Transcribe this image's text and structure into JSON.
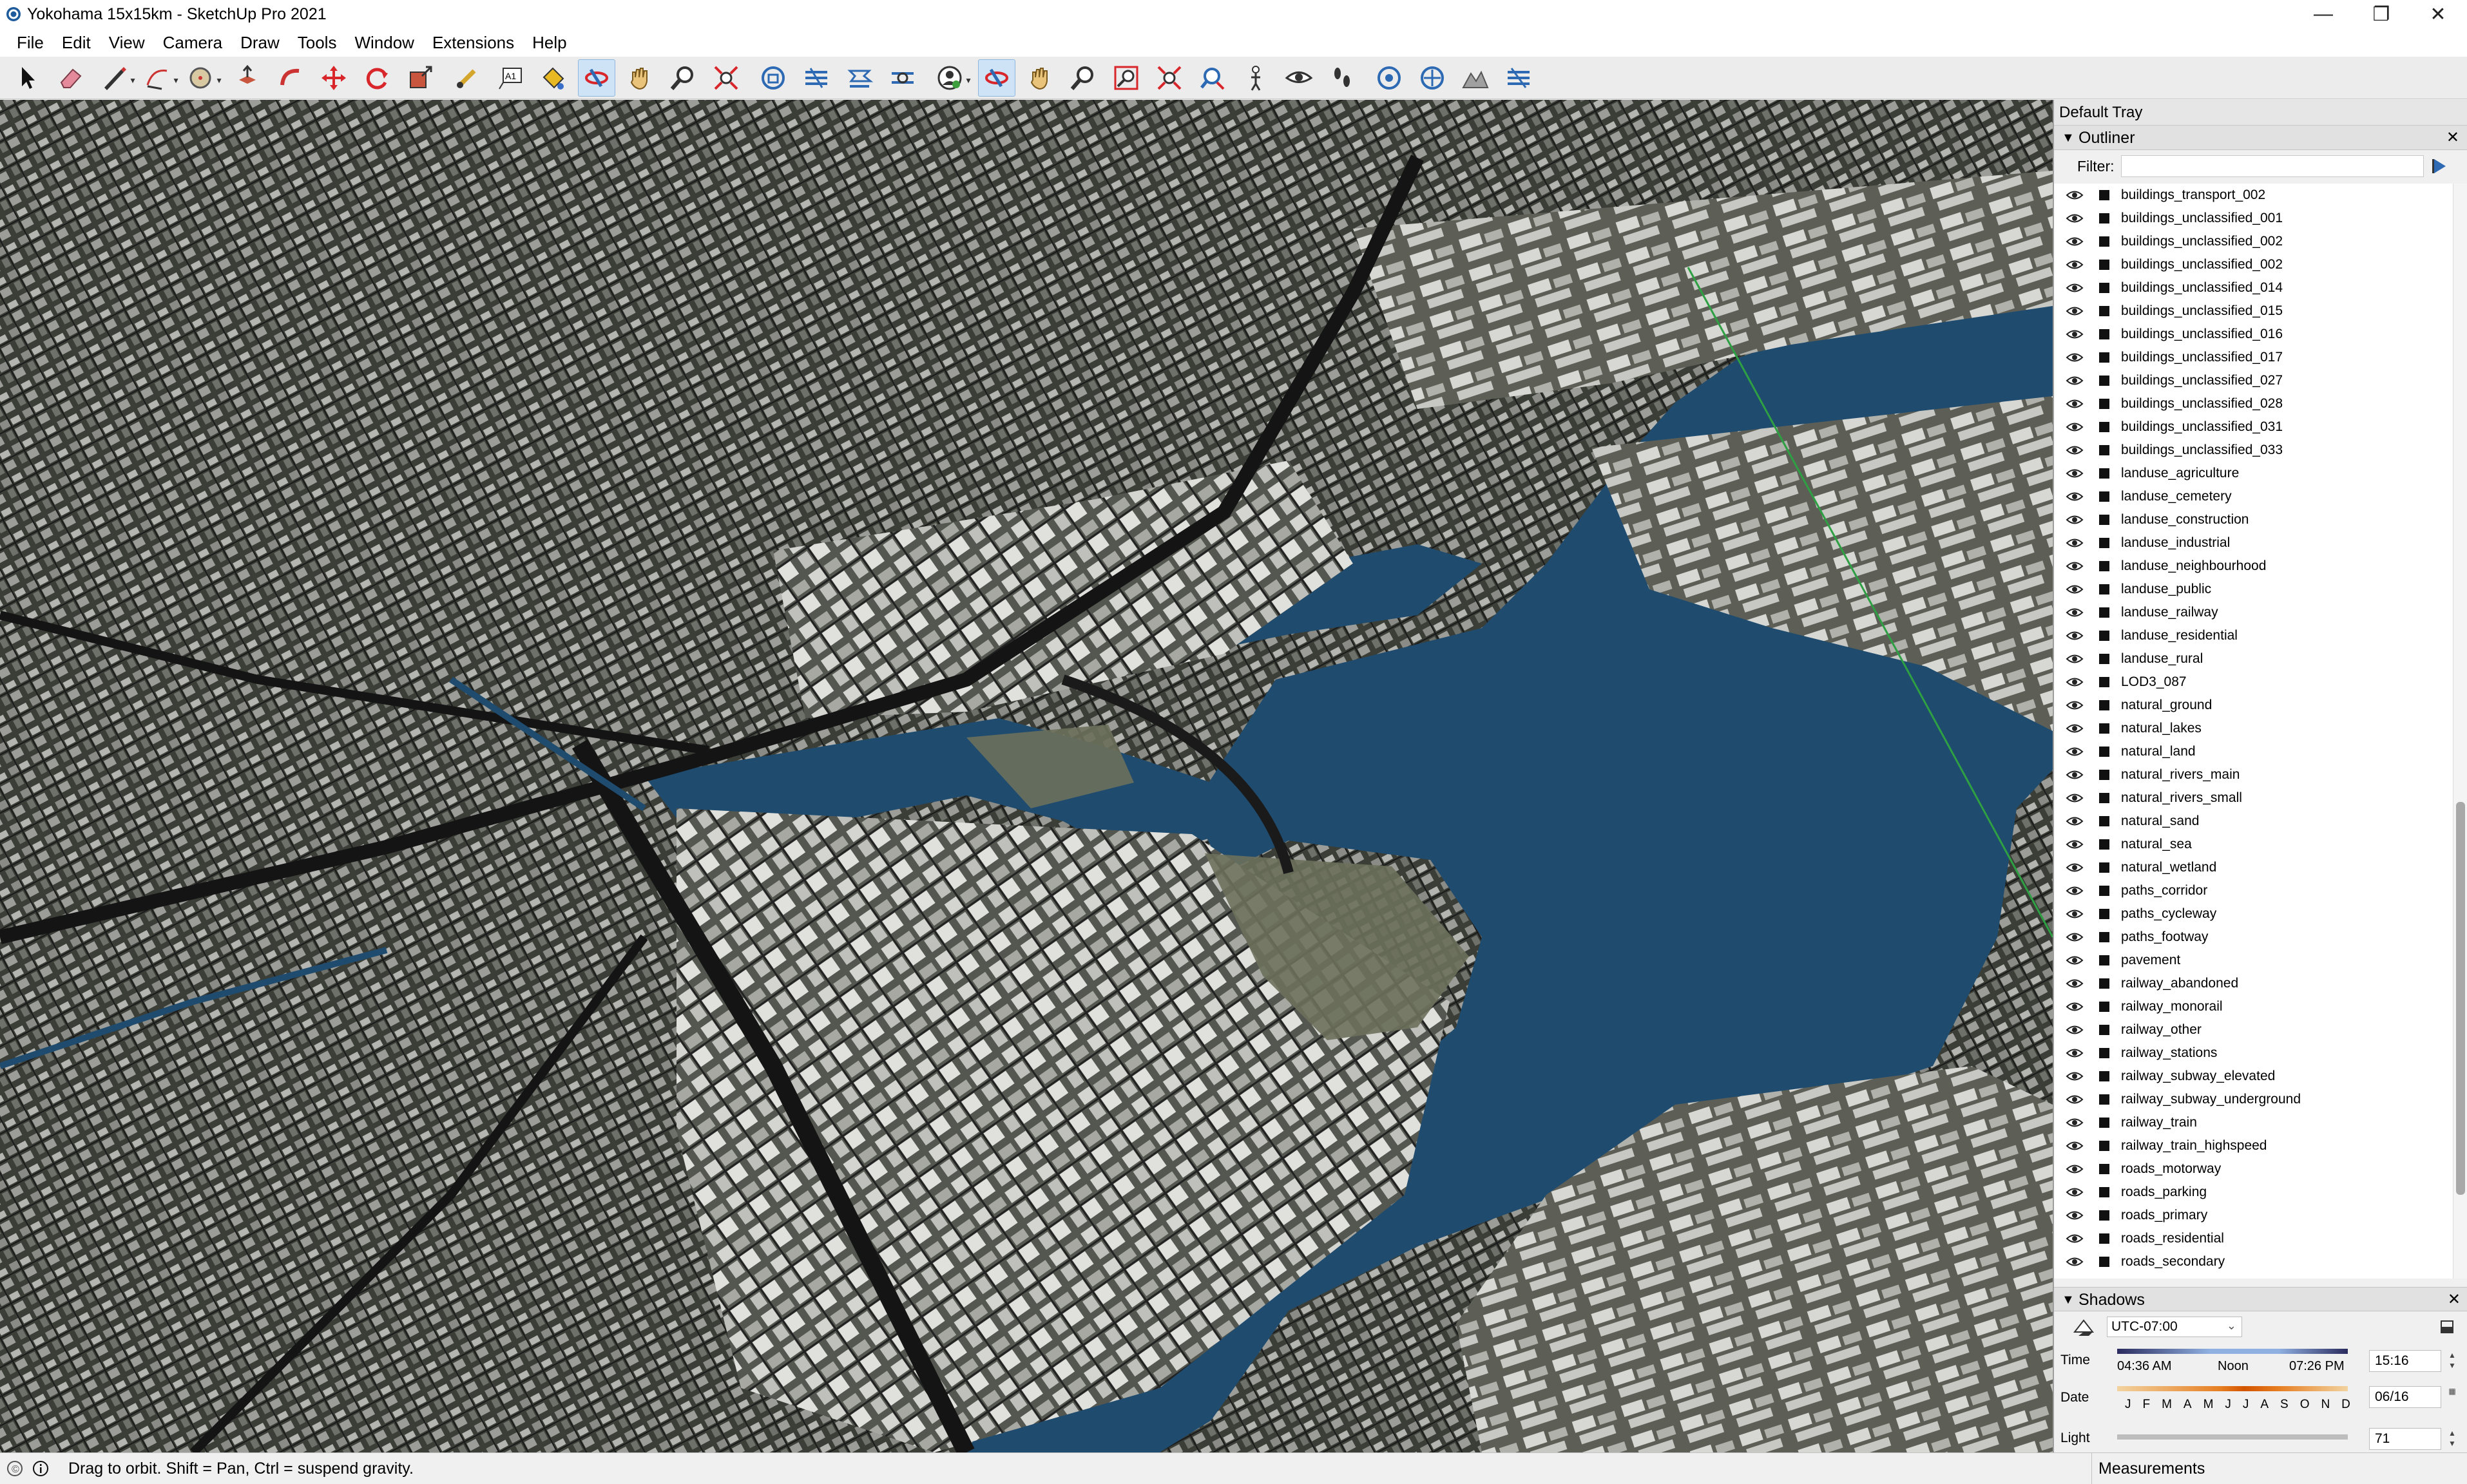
{
  "window": {
    "title": "Yokohama 15x15km - SketchUp Pro 2021",
    "controls": [
      "—",
      "❐",
      "✕"
    ]
  },
  "menu": [
    "File",
    "Edit",
    "View",
    "Camera",
    "Draw",
    "Tools",
    "Window",
    "Extensions",
    "Help"
  ],
  "toolbar": {
    "tools": [
      "select",
      "eraser",
      "line",
      "arc",
      "circle",
      "push-pull",
      "follow-me",
      "move",
      "rotate",
      "scale",
      "tape-measure",
      "text",
      "paint-bucket",
      "orbit",
      "pan",
      "zoom",
      "zoom-extents",
      "section-plane",
      "section-display",
      "section-cuts",
      "section-fill",
      "user",
      "orbit",
      "pan",
      "zoom",
      "zoom-window",
      "zoom-extents",
      "previous-view",
      "position-camera",
      "look-around",
      "walk",
      "add-location",
      "geo-location",
      "terrain",
      "photo-textures"
    ],
    "active_tools": [
      13,
      22
    ]
  },
  "tray": {
    "title": "Default Tray",
    "outliner": {
      "title": "Outliner",
      "filter_label": "Filter:",
      "filter_value": "",
      "items": [
        "buildings_transport_002",
        "buildings_unclassified_001",
        "buildings_unclassified_002",
        "buildings_unclassified_002",
        "buildings_unclassified_014",
        "buildings_unclassified_015",
        "buildings_unclassified_016",
        "buildings_unclassified_017",
        "buildings_unclassified_027",
        "buildings_unclassified_028",
        "buildings_unclassified_031",
        "buildings_unclassified_033",
        "landuse_agriculture",
        "landuse_cemetery",
        "landuse_construction",
        "landuse_industrial",
        "landuse_neighbourhood",
        "landuse_public",
        "landuse_railway",
        "landuse_residential",
        "landuse_rural",
        "LOD3_087",
        "natural_ground",
        "natural_lakes",
        "natural_land",
        "natural_rivers_main",
        "natural_rivers_small",
        "natural_sand",
        "natural_sea",
        "natural_wetland",
        "paths_corridor",
        "paths_cycleway",
        "paths_footway",
        "pavement",
        "railway_abandoned",
        "railway_monorail",
        "railway_other",
        "railway_stations",
        "railway_subway_elevated",
        "railway_subway_underground",
        "railway_train",
        "railway_train_highspeed",
        "roads_motorway",
        "roads_parking",
        "roads_primary",
        "roads_residential",
        "roads_secondary"
      ]
    },
    "shadows": {
      "title": "Shadows",
      "timezone": "UTC-07:00",
      "time_label": "Time",
      "sunrise": "04:36 AM",
      "noon": "Noon",
      "sunset": "07:26 PM",
      "time_value": "15:16",
      "date_label": "Date",
      "months": [
        "J",
        "F",
        "M",
        "A",
        "M",
        "J",
        "J",
        "A",
        "S",
        "O",
        "N",
        "D"
      ],
      "date_value": "06/16",
      "light_label": "Light",
      "light_value": "71"
    }
  },
  "status": {
    "message": "Drag to orbit. Shift = Pan, Ctrl = suspend gravity.",
    "measurements_label": "Measurements"
  },
  "colors": {
    "sea": "#1f4b6e",
    "land": "#41443d",
    "buildings": "#c9c9c9",
    "park": "#6b705b",
    "highlight": "#cfe3f7"
  }
}
